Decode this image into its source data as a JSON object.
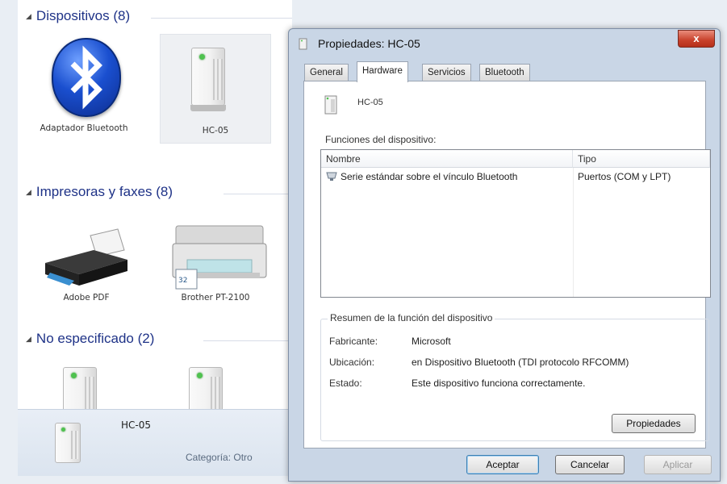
{
  "devices_window": {
    "sections": {
      "devices": "Dispositivos (8)",
      "printers": "Impresoras y faxes (8)",
      "unspecified": "No especificado (2)"
    },
    "devices": [
      {
        "label": "Adaptador Bluetooth",
        "icon": "bluetooth-icon"
      },
      {
        "label": "HC-05",
        "icon": "device-tower-icon"
      }
    ],
    "printers": [
      {
        "label": "Adobe PDF",
        "icon": "printer-icon"
      },
      {
        "label": "Brother PT-2100",
        "icon": "printer-fax-icon"
      }
    ],
    "details": {
      "name": "HC-05",
      "category": "Categoría: Otro"
    }
  },
  "dialog": {
    "title": "Propiedades: HC-05",
    "close_label": "x",
    "tabs": [
      "General",
      "Hardware",
      "Servicios",
      "Bluetooth"
    ],
    "active_tab": "Hardware",
    "device_name": "HC-05",
    "functions_label": "Funciones del dispositivo:",
    "columns": [
      "Nombre",
      "Tipo"
    ],
    "rows": [
      {
        "name": "Serie estándar sobre el vínculo Bluetooth",
        "type": "Puertos (COM y LPT)"
      }
    ],
    "summary": {
      "legend": "Resumen de la función del dispositivo",
      "fields": [
        {
          "key": "Fabricante:",
          "value": "Microsoft"
        },
        {
          "key": "Ubicación:",
          "value": "en Dispositivo Bluetooth (TDI protocolo RFCOMM)"
        },
        {
          "key": "Estado:",
          "value": "Este dispositivo funciona correctamente."
        }
      ],
      "properties_button": "Propiedades"
    },
    "buttons": {
      "ok": "Aceptar",
      "cancel": "Cancelar",
      "apply": "Aplicar"
    }
  }
}
